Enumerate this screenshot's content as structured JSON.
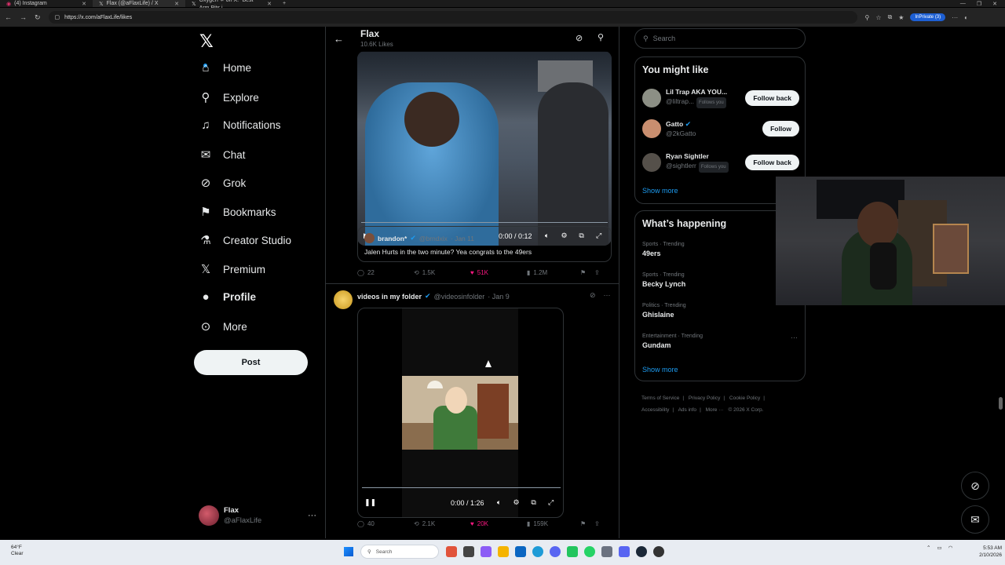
{
  "browser": {
    "tabs": [
      {
        "label": "(4) Instagram"
      },
      {
        "label": "Flax (@aFlaxLife) / X"
      },
      {
        "label": "Oxygen 🌣 on X: \"Best Arm Pits i..."
      }
    ],
    "url": "https://x.com/aFlaxLife/likes",
    "inprivate": "InPrivate (3)"
  },
  "nav": {
    "items": [
      {
        "label": "Home",
        "icon": "home-icon",
        "glyph": "⌂"
      },
      {
        "label": "Explore",
        "icon": "search-icon",
        "glyph": "⚲"
      },
      {
        "label": "Notifications",
        "icon": "bell-icon",
        "glyph": "🔔"
      },
      {
        "label": "Chat",
        "icon": "mail-icon",
        "glyph": "✉"
      },
      {
        "label": "Grok",
        "icon": "grok-icon",
        "glyph": "⊘"
      },
      {
        "label": "Bookmarks",
        "icon": "bookmark-icon",
        "glyph": "⚑"
      },
      {
        "label": "Creator Studio",
        "icon": "flask-icon",
        "glyph": "⚗"
      },
      {
        "label": "Premium",
        "icon": "x-logo-icon",
        "glyph": "𝕏"
      },
      {
        "label": "Profile",
        "icon": "person-icon",
        "glyph": "👤"
      },
      {
        "label": "More",
        "icon": "more-circle-icon",
        "glyph": "⊙"
      }
    ],
    "post_label": "Post",
    "account": {
      "name": "Flax",
      "handle": "@aFlaxLife"
    }
  },
  "header": {
    "title": "Flax",
    "subtitle": "10.6K Likes"
  },
  "post1": {
    "video_time": "0:00 / 0:12",
    "quote": {
      "name": "brandon*",
      "handle": "@brndxix",
      "date": "· Jan 11",
      "text": "Jalen Hurts in the two minute? Yea congrats to the 49ers"
    },
    "stats": {
      "replies": "22",
      "reposts": "1.5K",
      "likes": "51K",
      "views": "1.2M"
    }
  },
  "post2": {
    "name": "videos in my folder",
    "handle": "@videosinfolder",
    "date": "· Jan 9",
    "video_time": "0:00 / 1:26",
    "stats": {
      "replies": "40",
      "reposts": "2.1K",
      "likes": "20K",
      "views": "159K"
    }
  },
  "sidebar": {
    "search_placeholder": "Search",
    "you_might_like": {
      "title": "You might like",
      "users": [
        {
          "name": "Lil Trap AKA YOU...",
          "handle": "@liltrap...",
          "follows_you": "Follows you",
          "button": "Follow back"
        },
        {
          "name": "Gatto",
          "handle": "@2kGatto",
          "follows_you": "",
          "button": "Follow"
        },
        {
          "name": "Ryan Sightler",
          "handle": "@sightlerr",
          "follows_you": "Follows you",
          "button": "Follow back"
        }
      ],
      "show_more": "Show more"
    },
    "happening": {
      "title": "What’s happening",
      "trends": [
        {
          "category": "Sports · Trending",
          "name": "49ers"
        },
        {
          "category": "Sports · Trending",
          "name": "Becky Lynch"
        },
        {
          "category": "Politics · Trending",
          "name": "Ghislaine"
        },
        {
          "category": "Entertainment · Trending",
          "name": "Gundam"
        }
      ],
      "show_more": "Show more"
    },
    "footer": [
      "Terms of Service",
      "|",
      "Privacy Policy",
      "|",
      "Cookie Policy",
      "|",
      "Accessibility",
      "|",
      "Ads info",
      "|",
      "More ···",
      "© 2026 X Corp."
    ]
  },
  "taskbar": {
    "weather_temp": "64°F",
    "weather_desc": "Clear",
    "search_placeholder": "Search",
    "time": "5:53 AM",
    "date": "2/10/2026"
  },
  "colors": {
    "accent": "#1d9bf0",
    "like": "#f91880",
    "bg": "#000000",
    "border": "#2f3336"
  }
}
